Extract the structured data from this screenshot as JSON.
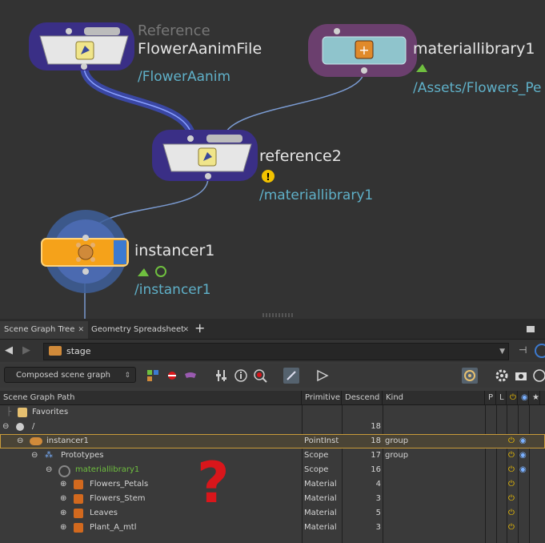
{
  "network": {
    "nodes": [
      {
        "id": "reference-flower",
        "type_label": "Reference",
        "title": "FlowerAanimFile",
        "path": "/FlowerAanim"
      },
      {
        "id": "materiallibrary1",
        "title": "materiallibrary1",
        "path": "/Assets/Flowers_Pe"
      },
      {
        "id": "reference2",
        "title": "reference2",
        "path": "/materiallibrary1"
      },
      {
        "id": "instancer1",
        "title": "instancer1",
        "path": "/instancer1"
      }
    ],
    "annotation": "?"
  },
  "tabs": [
    {
      "label": "Scene Graph Tree"
    },
    {
      "label": "Geometry Spreadsheet"
    }
  ],
  "path_field": "stage",
  "view_mode": "Composed scene graph",
  "columns": [
    {
      "label": "Scene Graph Path"
    },
    {
      "label": "Primitive"
    },
    {
      "label": "Descend"
    },
    {
      "label": "Kind"
    },
    {
      "label": "P"
    },
    {
      "label": "L"
    }
  ],
  "rows": [
    {
      "name": "Favorites",
      "prim": "",
      "desc": "",
      "kind": ""
    },
    {
      "name": "/",
      "prim": "",
      "desc": "18",
      "kind": ""
    },
    {
      "name": "instancer1",
      "prim": "PointInst",
      "desc": "18",
      "kind": "group"
    },
    {
      "name": "Prototypes",
      "prim": "Scope",
      "desc": "17",
      "kind": "group"
    },
    {
      "name": "materiallibrary1",
      "prim": "Scope",
      "desc": "16",
      "kind": ""
    },
    {
      "name": "Flowers_Petals",
      "prim": "Material",
      "desc": "4",
      "kind": ""
    },
    {
      "name": "Flowers_Stem",
      "prim": "Material",
      "desc": "3",
      "kind": ""
    },
    {
      "name": "Leaves",
      "prim": "Material",
      "desc": "5",
      "kind": ""
    },
    {
      "name": "Plant_A_mtl",
      "prim": "Material",
      "desc": "3",
      "kind": ""
    }
  ],
  "colors": {
    "network_bg": "#333333",
    "node_purple": "#3a2f86",
    "node_pink": "#6b3f6e",
    "path_cyan": "#5fb0c8",
    "instancer_orange": "#f5a21a",
    "selection_gold": "#c89a3a",
    "annotation_red": "#d9161b",
    "material_lib_green": "#6fbf3f"
  }
}
